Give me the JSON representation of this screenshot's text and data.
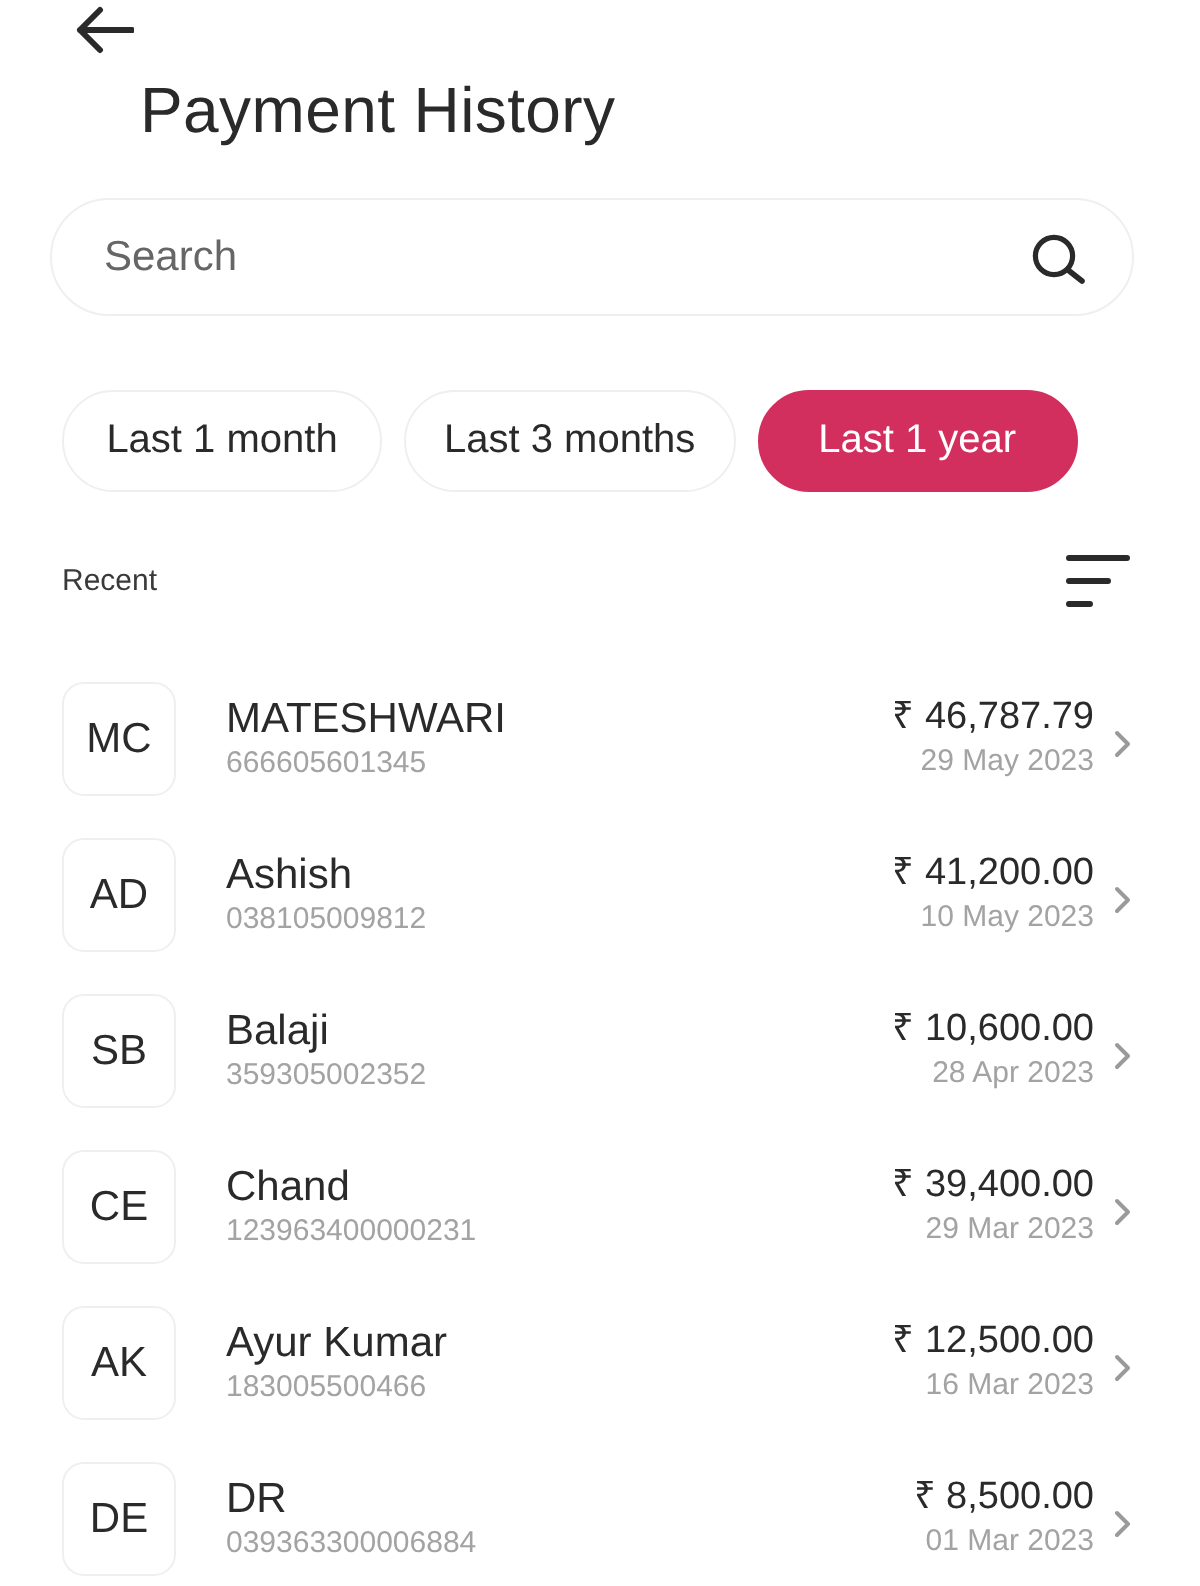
{
  "header": {
    "title": "Payment History"
  },
  "search": {
    "placeholder": "Search"
  },
  "filters": [
    {
      "label": "Last 1 month",
      "selected": false
    },
    {
      "label": "Last 3 months",
      "selected": false
    },
    {
      "label": "Last 1 year",
      "selected": true
    }
  ],
  "section": {
    "label": "Recent"
  },
  "payments": [
    {
      "initials": "MC",
      "name": "MATESHWARI",
      "account": "666605601345",
      "amount": "₹ 46,787.79",
      "date": "29 May 2023"
    },
    {
      "initials": "AD",
      "name": "Ashish",
      "account": "038105009812",
      "amount": "₹ 41,200.00",
      "date": "10 May 2023"
    },
    {
      "initials": "SB",
      "name": "Balaji",
      "account": "359305002352",
      "amount": "₹ 10,600.00",
      "date": "28 Apr 2023"
    },
    {
      "initials": "CE",
      "name": "Chand",
      "account": "123963400000231",
      "amount": "₹ 39,400.00",
      "date": "29 Mar 2023"
    },
    {
      "initials": "AK",
      "name": "Ayur Kumar",
      "account": "183005500466",
      "amount": "₹ 12,500.00",
      "date": "16 Mar 2023"
    },
    {
      "initials": "DE",
      "name": "DR",
      "account": "039363300006884",
      "amount": "₹ 8,500.00",
      "date": "01 Mar 2023"
    }
  ]
}
